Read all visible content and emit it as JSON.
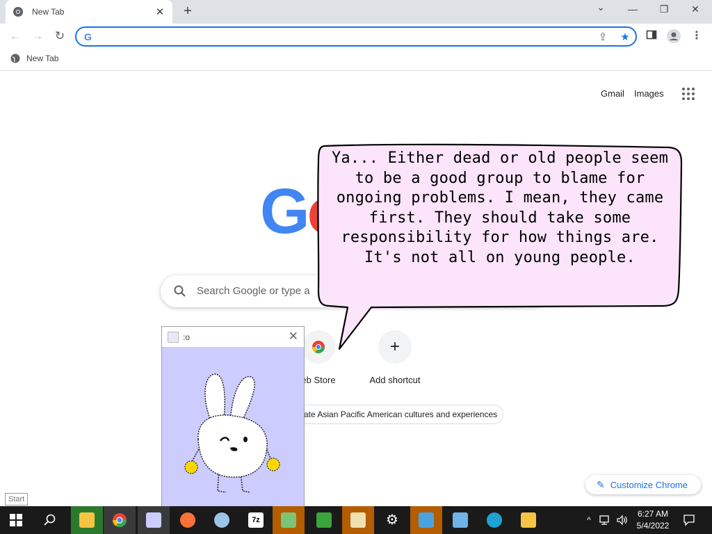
{
  "browser": {
    "tab_title": "New Tab",
    "tab_close": "✕",
    "new_tab": "+",
    "minimize": "—",
    "restore": "❐",
    "close": "✕",
    "caret": "⌄",
    "omnibox_value": "",
    "bookmark_label": "New Tab"
  },
  "ntp": {
    "gmail": "Gmail",
    "images": "Images",
    "logo_letters": [
      "G",
      "o"
    ],
    "search_placeholder": "Search Google or type a",
    "shortcuts": [
      {
        "label": "eb Store",
        "icon": "chrome-web-store-icon"
      },
      {
        "label": "Add shortcut",
        "icon": "plus-icon",
        "glyph": "+"
      }
    ],
    "promo": "ate Asian Pacific American cultures and experiences",
    "customize": "Customize Chrome",
    "customize_icon": "✎"
  },
  "bubble": {
    "text": "Ya... Either dead or old people seem to be a good group to blame for ongoing problems. I mean, they came first. They should take some responsibility for how things are. It's not all on young people.",
    "fill": "#fce4fb"
  },
  "pet_window": {
    "title": ":o",
    "close": "✕",
    "background": "#ccccff"
  },
  "start_tooltip": "Start",
  "taskbar": {
    "clock_time": "6:27 AM",
    "clock_date": "5/4/2022",
    "apps": [
      {
        "name": "search",
        "color": "#ffffff"
      },
      {
        "name": "file-explorer",
        "color": "#f6c342"
      },
      {
        "name": "chrome",
        "color": "#4285f4"
      },
      {
        "name": "bunny-pet",
        "color": "#ccccff"
      },
      {
        "name": "firefox",
        "color": "#ff7139"
      },
      {
        "name": "paint",
        "color": "#9bc4e8"
      },
      {
        "name": "7zip",
        "color": "#ffffff"
      },
      {
        "name": "notepad-chart",
        "color": "#7cc576"
      },
      {
        "name": "frog-app",
        "color": "#3ba53b"
      },
      {
        "name": "photos",
        "color": "#f0e0b0"
      },
      {
        "name": "settings",
        "color": "#ffffff"
      },
      {
        "name": "remote-desktop",
        "color": "#4aa3df"
      },
      {
        "name": "network-app",
        "color": "#6fb3e8"
      },
      {
        "name": "edge",
        "color": "#1fa2d4"
      },
      {
        "name": "folder-person",
        "color": "#f6c342"
      }
    ],
    "tray_caret": "^",
    "tray_network": "⊡",
    "tray_volume": "🔊"
  }
}
